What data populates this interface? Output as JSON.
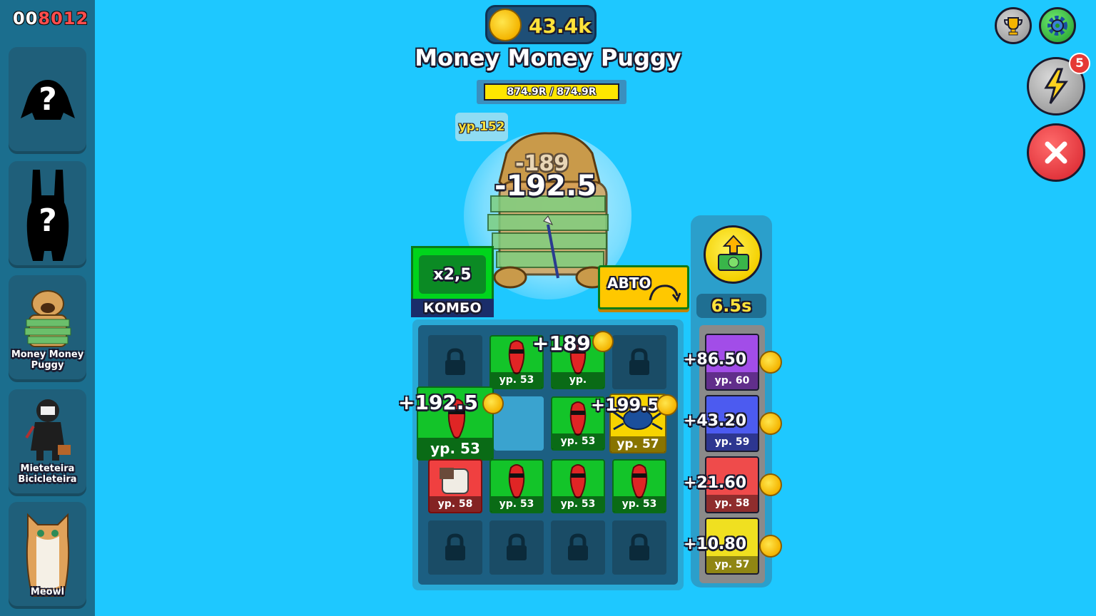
{
  "score": {
    "zeros": "00",
    "number": "8012"
  },
  "sidebar": {
    "items": [
      {
        "label": "",
        "state": "locked-silhouette",
        "icon": "unknown-creature-icon"
      },
      {
        "label": "",
        "state": "locked-silhouette",
        "icon": "unknown-bunny-icon"
      },
      {
        "label": "Money Money Puggy",
        "state": "selected",
        "icon": "money-pug-icon"
      },
      {
        "label": "Mieteteira Bicicleteira",
        "state": "unlocked",
        "icon": "ninja-character-icon"
      },
      {
        "label": "Meowl",
        "state": "unlocked",
        "icon": "owl-cat-icon"
      }
    ]
  },
  "header": {
    "coins": "43.4k",
    "boss_name": "Money Money Puggy",
    "hp_text": "874.9R / 874.9R",
    "hp_fraction": 1.0,
    "level_tag": "ур.152"
  },
  "damage": {
    "main": "-192.5",
    "ghost": "-189"
  },
  "combo": {
    "multiplier": "x2,5",
    "label": "КОМБО"
  },
  "auto": {
    "label": "АВТО"
  },
  "grid": {
    "rows": [
      [
        {
          "type": "locked"
        },
        {
          "type": "green",
          "level": "ур. 53"
        },
        {
          "type": "green",
          "level": "ур."
        },
        {
          "type": "locked"
        }
      ],
      [
        {
          "type": "green",
          "level": "ур. 53"
        },
        {
          "type": "empty"
        },
        {
          "type": "green",
          "level": "ур. 53"
        },
        {
          "type": "yellow",
          "level": "ур. 57"
        }
      ],
      [
        {
          "type": "red",
          "level": "ур. 58"
        },
        {
          "type": "green",
          "level": "ур. 53"
        },
        {
          "type": "green",
          "level": "ур. 53"
        },
        {
          "type": "green",
          "level": "ур. 53"
        }
      ],
      [
        {
          "type": "locked"
        },
        {
          "type": "locked"
        },
        {
          "type": "locked"
        },
        {
          "type": "locked"
        }
      ]
    ]
  },
  "floating_numbers": [
    "+189",
    "+192.5",
    "+199.5"
  ],
  "upgrade": {
    "timer": "6.5s"
  },
  "income_stacks": [
    {
      "color": "#a24de8",
      "level": "ур. 60",
      "income": "+86.50"
    },
    {
      "color": "#4c5bf0",
      "level": "ур. 59",
      "income": "+43.20"
    },
    {
      "color": "#ef4b4b",
      "level": "ур. 58",
      "income": "+21.60"
    },
    {
      "color": "#f0e020",
      "level": "ур. 57",
      "income": "+10.80"
    }
  ],
  "buttons": {
    "boost_badge": "5"
  },
  "colors": {
    "background": "#1ec8ff",
    "sidebar": "#1b6e8e",
    "coin_text": "#ffe23a",
    "combo_green": "#00d41c",
    "auto_yellow": "#ffc800"
  }
}
